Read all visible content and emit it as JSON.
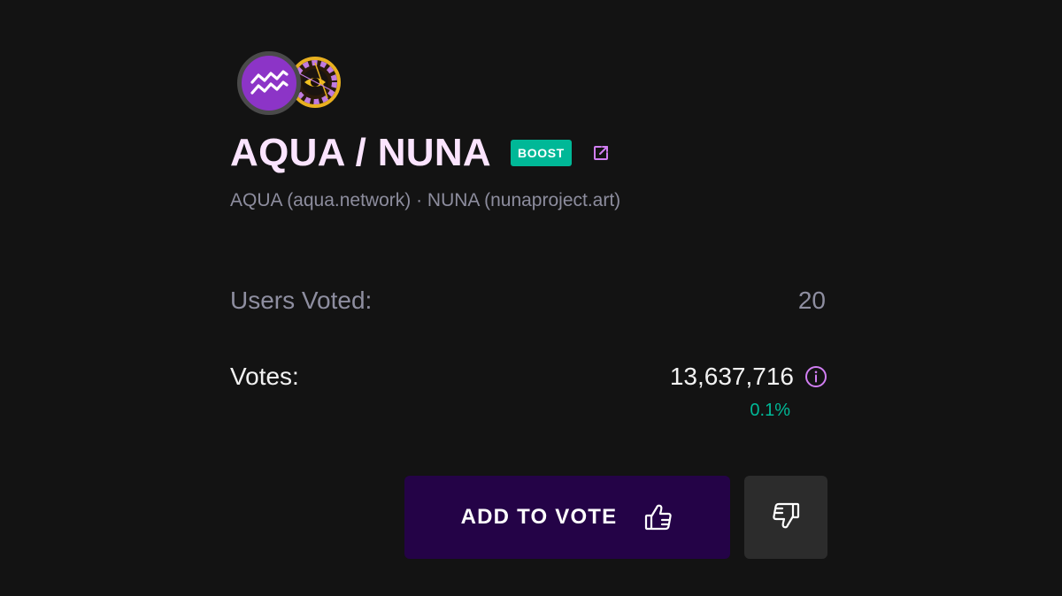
{
  "pair": {
    "title": "AQUA / NUNA",
    "badge": "BOOST",
    "subtitle": "AQUA (aqua.network) · NUNA (nunaproject.art)",
    "icons": {
      "asset_a": "aqua-logo-icon",
      "asset_b": "nuna-logo-icon",
      "external": "external-link-icon"
    },
    "colors": {
      "title": "#fbe4ff",
      "badge_bg": "#00b897",
      "accent_pink": "#d17ef2",
      "aqua_purple": "#8c34c7"
    }
  },
  "stats": {
    "users_voted_label": "Users Voted:",
    "users_voted_value": "20",
    "votes_label": "Votes:",
    "votes_value": "13,637,716",
    "votes_share": "0.1%",
    "info_icon": "info-icon",
    "colors": {
      "share": "#00b897"
    }
  },
  "actions": {
    "add_to_vote_label": "ADD TO VOTE",
    "add_to_vote_icon": "thumb-up-icon",
    "downvote_icon": "thumb-down-icon",
    "colors": {
      "add_to_vote_bg": "#240347",
      "downvote_bg": "#2c2c2c"
    }
  }
}
